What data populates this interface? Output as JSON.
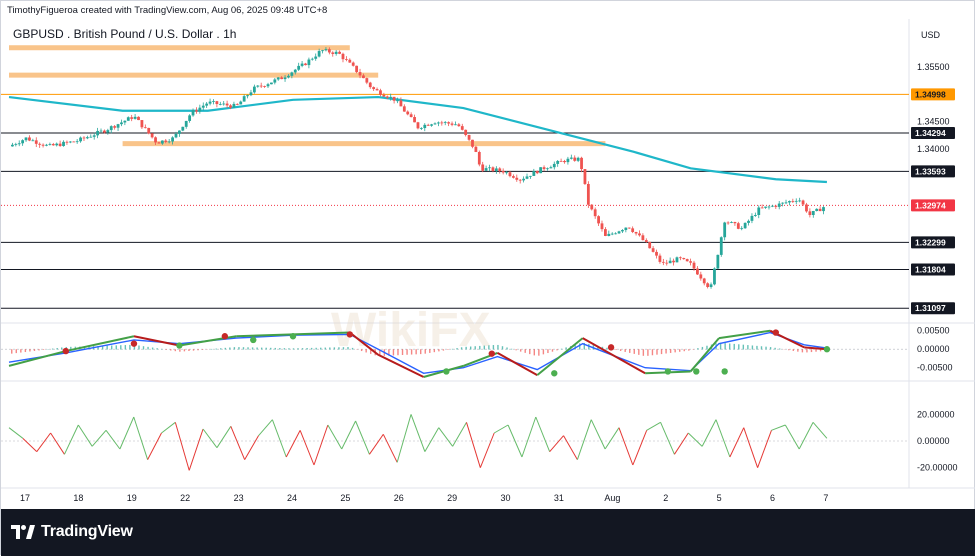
{
  "header": {
    "attribution": "TimothyFigueroa created with TradingView.com, Aug 06, 2025 09:48 UTC+8"
  },
  "footer": {
    "brand": "TradingView"
  },
  "watermark": "WikiFX",
  "colors": {
    "up": "#26a69a",
    "down": "#ef5350",
    "ma": "#1fb7c9",
    "zone": "#f9c48a",
    "level": "#131722",
    "macd_blue": "#2962ff",
    "macd_red": "#b71c1c",
    "macd_green_line": "#43a047",
    "rsi_green": "#66bb6a",
    "rsi_red": "#e53935",
    "current": "#f23645",
    "highlight": "#ff9800"
  },
  "chart_data": [
    {
      "type": "candlestick",
      "title": "GBPUSD . British Pound / U.S. Dollar . 1h",
      "currency": "USD",
      "x_ticks": [
        "17",
        "18",
        "19",
        "22",
        "23",
        "24",
        "25",
        "26",
        "29",
        "30",
        "31",
        "Aug",
        "2",
        "5",
        "6",
        "7"
      ],
      "y_ticks": [
        1.355,
        1.345,
        1.34
      ],
      "y_range": [
        1.309,
        1.359
      ],
      "moving_average": {
        "name": "MA",
        "points": [
          {
            "x": 0.0,
            "y": 1.3495
          },
          {
            "x": 2.0,
            "y": 1.347
          },
          {
            "x": 3.5,
            "y": 1.347
          },
          {
            "x": 5.0,
            "y": 1.349
          },
          {
            "x": 6.5,
            "y": 1.3495
          },
          {
            "x": 8.0,
            "y": 1.3475
          },
          {
            "x": 9.5,
            "y": 1.3435
          },
          {
            "x": 11.0,
            "y": 1.3395
          },
          {
            "x": 12.0,
            "y": 1.3365
          },
          {
            "x": 13.5,
            "y": 1.3345
          },
          {
            "x": 14.4,
            "y": 1.334
          }
        ]
      },
      "price_path": [
        {
          "x": 0.0,
          "y": 1.3405
        },
        {
          "x": 0.3,
          "y": 1.342
        },
        {
          "x": 0.7,
          "y": 1.3405
        },
        {
          "x": 1.2,
          "y": 1.3415
        },
        {
          "x": 1.7,
          "y": 1.3435
        },
        {
          "x": 2.2,
          "y": 1.346
        },
        {
          "x": 2.6,
          "y": 1.3412
        },
        {
          "x": 2.9,
          "y": 1.342
        },
        {
          "x": 3.2,
          "y": 1.3465
        },
        {
          "x": 3.5,
          "y": 1.3485
        },
        {
          "x": 4.0,
          "y": 1.3478
        },
        {
          "x": 4.3,
          "y": 1.351
        },
        {
          "x": 4.8,
          "y": 1.353
        },
        {
          "x": 5.2,
          "y": 1.3555
        },
        {
          "x": 5.5,
          "y": 1.358
        },
        {
          "x": 5.8,
          "y": 1.3575
        },
        {
          "x": 6.1,
          "y": 1.3545
        },
        {
          "x": 6.4,
          "y": 1.351
        },
        {
          "x": 6.8,
          "y": 1.349
        },
        {
          "x": 7.2,
          "y": 1.344
        },
        {
          "x": 7.5,
          "y": 1.345
        },
        {
          "x": 7.9,
          "y": 1.3445
        },
        {
          "x": 8.2,
          "y": 1.34
        },
        {
          "x": 8.3,
          "y": 1.3365
        },
        {
          "x": 8.7,
          "y": 1.336
        },
        {
          "x": 9.0,
          "y": 1.3345
        },
        {
          "x": 9.4,
          "y": 1.3365
        },
        {
          "x": 9.8,
          "y": 1.338
        },
        {
          "x": 10.05,
          "y": 1.3382
        },
        {
          "x": 10.2,
          "y": 1.33
        },
        {
          "x": 10.5,
          "y": 1.324
        },
        {
          "x": 10.9,
          "y": 1.326
        },
        {
          "x": 11.2,
          "y": 1.323
        },
        {
          "x": 11.5,
          "y": 1.319
        },
        {
          "x": 11.8,
          "y": 1.32
        },
        {
          "x": 12.0,
          "y": 1.319
        },
        {
          "x": 12.35,
          "y": 1.3145
        },
        {
          "x": 12.6,
          "y": 1.327
        },
        {
          "x": 12.9,
          "y": 1.3255
        },
        {
          "x": 13.2,
          "y": 1.329
        },
        {
          "x": 13.6,
          "y": 1.33
        },
        {
          "x": 13.9,
          "y": 1.331
        },
        {
          "x": 14.1,
          "y": 1.328
        },
        {
          "x": 14.4,
          "y": 1.3298
        }
      ],
      "horizontal_levels": [
        {
          "label": "1.34998",
          "value": 1.34998,
          "style": "highlight"
        },
        {
          "label": "1.34294",
          "value": 1.34294,
          "style": "level"
        },
        {
          "label": "1.33593",
          "value": 1.33593,
          "style": "level"
        },
        {
          "label": "1.32974",
          "value": 1.32974,
          "style": "current"
        },
        {
          "label": "1.32299",
          "value": 1.32299,
          "style": "level"
        },
        {
          "label": "1.31804",
          "value": 1.31804,
          "style": "level"
        },
        {
          "label": "1.31097",
          "value": 1.31097,
          "style": "level"
        }
      ],
      "supply_zones": [
        {
          "x_from": 0.0,
          "x_to": 6.0,
          "value": 1.3585
        },
        {
          "x_from": 0.0,
          "x_to": 6.5,
          "value": 1.3535
        },
        {
          "x_from": 2.0,
          "x_to": 10.5,
          "value": 1.341
        }
      ]
    },
    {
      "type": "line",
      "name": "MACD",
      "y_ticks": [
        0.005,
        0.0,
        -0.005
      ],
      "y_tick_labels": [
        "0.00500",
        "0.00000",
        "-0.00500"
      ],
      "y_range": [
        -0.0075,
        0.006
      ],
      "macd": [
        {
          "x": 0.0,
          "y": -0.0045
        },
        {
          "x": 1.0,
          "y": -0.0005
        },
        {
          "x": 2.2,
          "y": 0.0035
        },
        {
          "x": 3.0,
          "y": 0.001
        },
        {
          "x": 4.0,
          "y": 0.0035
        },
        {
          "x": 5.0,
          "y": 0.004
        },
        {
          "x": 6.0,
          "y": 0.0045
        },
        {
          "x": 6.5,
          "y": -0.0015
        },
        {
          "x": 7.3,
          "y": -0.0075
        },
        {
          "x": 8.0,
          "y": -0.0045
        },
        {
          "x": 8.6,
          "y": -0.001
        },
        {
          "x": 9.3,
          "y": -0.007
        },
        {
          "x": 10.1,
          "y": 0.003
        },
        {
          "x": 11.2,
          "y": -0.0065
        },
        {
          "x": 12.0,
          "y": -0.006
        },
        {
          "x": 12.5,
          "y": 0.003
        },
        {
          "x": 13.4,
          "y": 0.005
        },
        {
          "x": 14.0,
          "y": 0.0005
        },
        {
          "x": 14.4,
          "y": 0.0
        }
      ],
      "signal": [
        {
          "x": 0.0,
          "y": -0.0035
        },
        {
          "x": 1.0,
          "y": -0.001
        },
        {
          "x": 2.2,
          "y": 0.0025
        },
        {
          "x": 3.0,
          "y": 0.0015
        },
        {
          "x": 4.0,
          "y": 0.003
        },
        {
          "x": 5.0,
          "y": 0.0038
        },
        {
          "x": 6.0,
          "y": 0.004
        },
        {
          "x": 6.5,
          "y": 0.0
        },
        {
          "x": 7.3,
          "y": -0.0065
        },
        {
          "x": 8.0,
          "y": -0.005
        },
        {
          "x": 8.6,
          "y": -0.002
        },
        {
          "x": 9.3,
          "y": -0.0055
        },
        {
          "x": 10.1,
          "y": 0.0015
        },
        {
          "x": 11.2,
          "y": -0.005
        },
        {
          "x": 12.0,
          "y": -0.0058
        },
        {
          "x": 12.5,
          "y": 0.0015
        },
        {
          "x": 13.4,
          "y": 0.0045
        },
        {
          "x": 14.0,
          "y": 0.0012
        },
        {
          "x": 14.4,
          "y": 0.0003
        }
      ],
      "cross_markers": [
        {
          "x": 1.0,
          "y": -0.0005,
          "color": "red"
        },
        {
          "x": 2.2,
          "y": 0.0015,
          "color": "red"
        },
        {
          "x": 3.0,
          "y": 0.001,
          "color": "green"
        },
        {
          "x": 3.8,
          "y": 0.0035,
          "color": "red"
        },
        {
          "x": 4.3,
          "y": 0.0025,
          "color": "green"
        },
        {
          "x": 5.0,
          "y": 0.0035,
          "color": "green"
        },
        {
          "x": 6.0,
          "y": 0.004,
          "color": "red"
        },
        {
          "x": 7.7,
          "y": -0.006,
          "color": "green"
        },
        {
          "x": 8.5,
          "y": -0.0012,
          "color": "red"
        },
        {
          "x": 9.6,
          "y": -0.0065,
          "color": "green"
        },
        {
          "x": 10.6,
          "y": 0.0005,
          "color": "red"
        },
        {
          "x": 11.6,
          "y": -0.006,
          "color": "green"
        },
        {
          "x": 12.1,
          "y": -0.006,
          "color": "green"
        },
        {
          "x": 12.6,
          "y": -0.006,
          "color": "green"
        },
        {
          "x": 13.5,
          "y": 0.0045,
          "color": "red"
        },
        {
          "x": 14.4,
          "y": 0.0,
          "color": "green"
        }
      ]
    },
    {
      "type": "line",
      "name": "Oscillator",
      "y_ticks": [
        20,
        0,
        -20
      ],
      "y_tick_labels": [
        "20.00000",
        "0.00000",
        "-20.00000"
      ],
      "y_range": [
        -30,
        30
      ],
      "values": [
        10,
        2,
        -8,
        6,
        -10,
        12,
        -4,
        8,
        -6,
        18,
        -14,
        6,
        14,
        -22,
        9,
        -5,
        11,
        -14,
        4,
        16,
        -12,
        8,
        -18,
        12,
        -6,
        15,
        -10,
        5,
        -16,
        20,
        -8,
        10,
        -4,
        14,
        -20,
        6,
        12,
        -12,
        18,
        -8,
        4,
        -14,
        16,
        -6,
        10,
        -18,
        8,
        14,
        -10,
        6,
        -4,
        16,
        -12,
        10,
        -20,
        8,
        12,
        -6,
        14,
        2
      ]
    }
  ]
}
